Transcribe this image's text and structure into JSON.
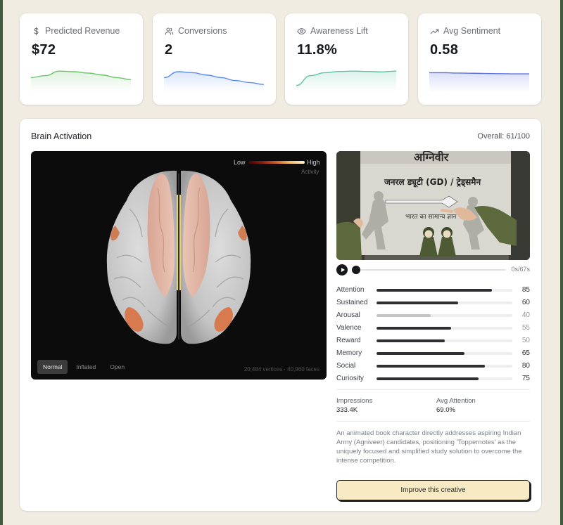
{
  "metrics": [
    {
      "label": "Predicted Revenue",
      "value": "$72",
      "icon": "dollar-icon",
      "color": "#6cc36a",
      "trend": [
        0.55,
        0.45,
        0.22,
        0.25,
        0.32,
        0.42,
        0.55,
        0.65
      ]
    },
    {
      "label": "Conversions",
      "value": "2",
      "icon": "users-icon",
      "color": "#5b8def",
      "trend": [
        0.55,
        0.25,
        0.3,
        0.42,
        0.55,
        0.7,
        0.8,
        0.9
      ]
    },
    {
      "label": "Awareness Lift",
      "value": "11.8%",
      "icon": "eye-icon",
      "color": "#5bc3a4",
      "trend": [
        0.95,
        0.45,
        0.3,
        0.24,
        0.22,
        0.24,
        0.26,
        0.22
      ]
    },
    {
      "label": "Avg Sentiment",
      "value": "0.58",
      "icon": "trending-up-icon",
      "color": "#5b6fe0",
      "trend": [
        0.3,
        0.3,
        0.32,
        0.33,
        0.34,
        0.35,
        0.36,
        0.36
      ]
    }
  ],
  "brain": {
    "title": "Brain Activation",
    "overall": "Overall: 61/100",
    "legend_low": "Low",
    "legend_high": "High",
    "legend_caption": "Activity",
    "view_tabs": [
      {
        "label": "Normal",
        "active": true
      },
      {
        "label": "Inflated",
        "active": false
      },
      {
        "label": "Open",
        "active": false
      }
    ],
    "mesh_stats": "20,484 vertices · 40,960 faces"
  },
  "video": {
    "sign_line1": "अग्निवीर",
    "sign_line2": "जनरल ड्यूटी (GD) / ट्रेड्समैन",
    "sign_line3": "भारत का सामान्य ज्ञान",
    "time": "0s/67s",
    "progress": 0
  },
  "scores": [
    {
      "label": "Attention",
      "value": 85,
      "muted": false
    },
    {
      "label": "Sustained",
      "value": 60,
      "muted": false
    },
    {
      "label": "Arousal",
      "value": 40,
      "muted": true
    },
    {
      "label": "Valence",
      "value": 55,
      "muted": false
    },
    {
      "label": "Reward",
      "value": 50,
      "muted": false
    },
    {
      "label": "Memory",
      "value": 65,
      "muted": false
    },
    {
      "label": "Social",
      "value": 80,
      "muted": false
    },
    {
      "label": "Curiosity",
      "value": 75,
      "muted": false
    }
  ],
  "stats": {
    "impressions_label": "Impressions",
    "impressions_value": "333.4K",
    "avg_attention_label": "Avg Attention",
    "avg_attention_value": "69.0%"
  },
  "description": "An animated book character directly addresses aspiring Indian Army (Agniveer) candidates, positioning 'Toppernotes' as the uniquely focused and simplified study solution to overcome the intense competition.",
  "cta_label": "Improve this creative"
}
